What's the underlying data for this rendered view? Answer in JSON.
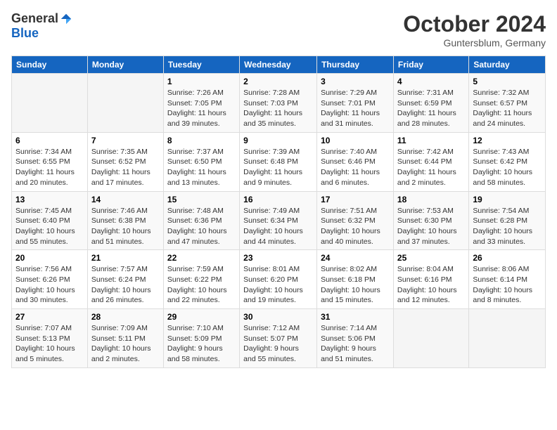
{
  "header": {
    "logo_general": "General",
    "logo_blue": "Blue",
    "month_title": "October 2024",
    "location": "Guntersblum, Germany"
  },
  "days_of_week": [
    "Sunday",
    "Monday",
    "Tuesday",
    "Wednesday",
    "Thursday",
    "Friday",
    "Saturday"
  ],
  "weeks": [
    [
      {
        "day": "",
        "text": ""
      },
      {
        "day": "",
        "text": ""
      },
      {
        "day": "1",
        "text": "Sunrise: 7:26 AM\nSunset: 7:05 PM\nDaylight: 11 hours and 39 minutes."
      },
      {
        "day": "2",
        "text": "Sunrise: 7:28 AM\nSunset: 7:03 PM\nDaylight: 11 hours and 35 minutes."
      },
      {
        "day": "3",
        "text": "Sunrise: 7:29 AM\nSunset: 7:01 PM\nDaylight: 11 hours and 31 minutes."
      },
      {
        "day": "4",
        "text": "Sunrise: 7:31 AM\nSunset: 6:59 PM\nDaylight: 11 hours and 28 minutes."
      },
      {
        "day": "5",
        "text": "Sunrise: 7:32 AM\nSunset: 6:57 PM\nDaylight: 11 hours and 24 minutes."
      }
    ],
    [
      {
        "day": "6",
        "text": "Sunrise: 7:34 AM\nSunset: 6:55 PM\nDaylight: 11 hours and 20 minutes."
      },
      {
        "day": "7",
        "text": "Sunrise: 7:35 AM\nSunset: 6:52 PM\nDaylight: 11 hours and 17 minutes."
      },
      {
        "day": "8",
        "text": "Sunrise: 7:37 AM\nSunset: 6:50 PM\nDaylight: 11 hours and 13 minutes."
      },
      {
        "day": "9",
        "text": "Sunrise: 7:39 AM\nSunset: 6:48 PM\nDaylight: 11 hours and 9 minutes."
      },
      {
        "day": "10",
        "text": "Sunrise: 7:40 AM\nSunset: 6:46 PM\nDaylight: 11 hours and 6 minutes."
      },
      {
        "day": "11",
        "text": "Sunrise: 7:42 AM\nSunset: 6:44 PM\nDaylight: 11 hours and 2 minutes."
      },
      {
        "day": "12",
        "text": "Sunrise: 7:43 AM\nSunset: 6:42 PM\nDaylight: 10 hours and 58 minutes."
      }
    ],
    [
      {
        "day": "13",
        "text": "Sunrise: 7:45 AM\nSunset: 6:40 PM\nDaylight: 10 hours and 55 minutes."
      },
      {
        "day": "14",
        "text": "Sunrise: 7:46 AM\nSunset: 6:38 PM\nDaylight: 10 hours and 51 minutes."
      },
      {
        "day": "15",
        "text": "Sunrise: 7:48 AM\nSunset: 6:36 PM\nDaylight: 10 hours and 47 minutes."
      },
      {
        "day": "16",
        "text": "Sunrise: 7:49 AM\nSunset: 6:34 PM\nDaylight: 10 hours and 44 minutes."
      },
      {
        "day": "17",
        "text": "Sunrise: 7:51 AM\nSunset: 6:32 PM\nDaylight: 10 hours and 40 minutes."
      },
      {
        "day": "18",
        "text": "Sunrise: 7:53 AM\nSunset: 6:30 PM\nDaylight: 10 hours and 37 minutes."
      },
      {
        "day": "19",
        "text": "Sunrise: 7:54 AM\nSunset: 6:28 PM\nDaylight: 10 hours and 33 minutes."
      }
    ],
    [
      {
        "day": "20",
        "text": "Sunrise: 7:56 AM\nSunset: 6:26 PM\nDaylight: 10 hours and 30 minutes."
      },
      {
        "day": "21",
        "text": "Sunrise: 7:57 AM\nSunset: 6:24 PM\nDaylight: 10 hours and 26 minutes."
      },
      {
        "day": "22",
        "text": "Sunrise: 7:59 AM\nSunset: 6:22 PM\nDaylight: 10 hours and 22 minutes."
      },
      {
        "day": "23",
        "text": "Sunrise: 8:01 AM\nSunset: 6:20 PM\nDaylight: 10 hours and 19 minutes."
      },
      {
        "day": "24",
        "text": "Sunrise: 8:02 AM\nSunset: 6:18 PM\nDaylight: 10 hours and 15 minutes."
      },
      {
        "day": "25",
        "text": "Sunrise: 8:04 AM\nSunset: 6:16 PM\nDaylight: 10 hours and 12 minutes."
      },
      {
        "day": "26",
        "text": "Sunrise: 8:06 AM\nSunset: 6:14 PM\nDaylight: 10 hours and 8 minutes."
      }
    ],
    [
      {
        "day": "27",
        "text": "Sunrise: 7:07 AM\nSunset: 5:13 PM\nDaylight: 10 hours and 5 minutes."
      },
      {
        "day": "28",
        "text": "Sunrise: 7:09 AM\nSunset: 5:11 PM\nDaylight: 10 hours and 2 minutes."
      },
      {
        "day": "29",
        "text": "Sunrise: 7:10 AM\nSunset: 5:09 PM\nDaylight: 9 hours and 58 minutes."
      },
      {
        "day": "30",
        "text": "Sunrise: 7:12 AM\nSunset: 5:07 PM\nDaylight: 9 hours and 55 minutes."
      },
      {
        "day": "31",
        "text": "Sunrise: 7:14 AM\nSunset: 5:06 PM\nDaylight: 9 hours and 51 minutes."
      },
      {
        "day": "",
        "text": ""
      },
      {
        "day": "",
        "text": ""
      }
    ]
  ]
}
